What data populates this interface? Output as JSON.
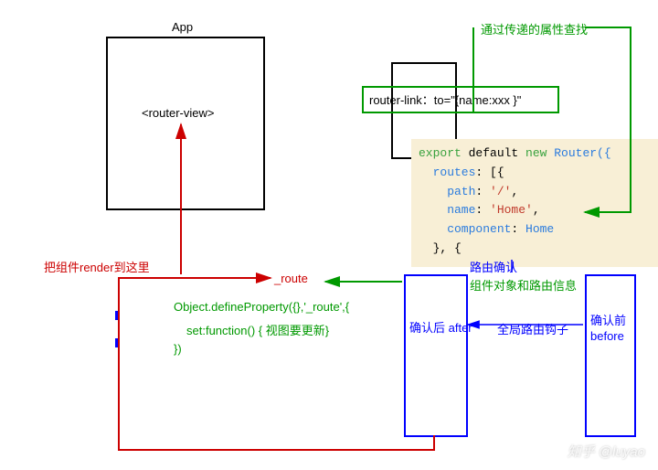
{
  "app": {
    "title": "App",
    "routerView": "<router-view>"
  },
  "routerLink": {
    "text": "router-link：to=\"{name:xxx }\""
  },
  "notes": {
    "lookupByProp": "通过传递的属性查找",
    "renderHere": "把组件render到这里",
    "route": "_route",
    "defineProp1": "Object.defineProperty({},'_route',{",
    "defineProp2": "set:function() { 视图要更新}",
    "defineProp3": "})",
    "routeConfirm": "路由确认",
    "compAndRouteInfo": "组件对象和路由信息",
    "afterConfirm": "确认后 after",
    "globalHook": "全局路由钩子",
    "beforeConfirm1": "确认前",
    "beforeConfirm2": "before"
  },
  "code": {
    "line1a": "export",
    "line1b": " default ",
    "line1c": "new",
    "line1d": " Router({",
    "line2a": "  routes",
    "line2b": ": [{",
    "line3a": "    path",
    "line3b": ": ",
    "line3c": "'/'",
    "line3d": ",",
    "line4a": "    name",
    "line4b": ": ",
    "line4c": "'Home'",
    "line4d": ",",
    "line5a": "    component",
    "line5b": ": ",
    "line5c": "Home",
    "line6": "  }, {"
  },
  "watermark": "知乎 @luyao"
}
